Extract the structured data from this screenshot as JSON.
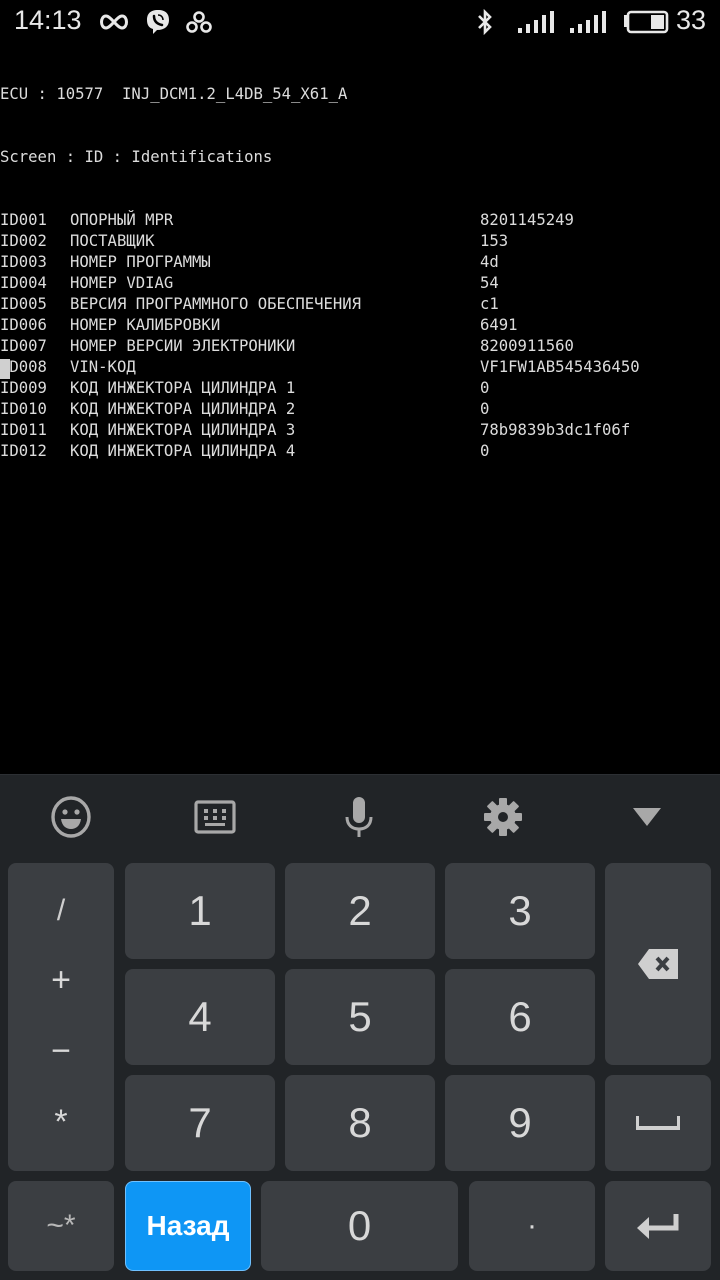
{
  "status_bar": {
    "time": "14:13",
    "left_icons": [
      "infinity-icon",
      "viber-icon",
      "cloverleaf-icon"
    ],
    "right_icons": [
      "bluetooth-icon",
      "signal-sim1-icon",
      "signal-sim2-icon",
      "battery-icon"
    ],
    "battery_level": "33"
  },
  "terminal": {
    "ecu_line": "ECU : 10577  INJ_DCM1.2_L4DB_54_X61_A",
    "screen_line": "Screen : ID : Identifications",
    "rows": [
      {
        "id": "ID001",
        "name": "ОПОРНЫЙ MPR",
        "value": "8201145249"
      },
      {
        "id": "ID002",
        "name": "ПОСТАВЩИК",
        "value": "153"
      },
      {
        "id": "ID003",
        "name": "НОМЕР ПРОГРАММЫ",
        "value": "4d"
      },
      {
        "id": "ID004",
        "name": "НОМЕР VDIAG",
        "value": "54"
      },
      {
        "id": "ID005",
        "name": "ВЕРСИЯ ПРОГРАММНОГО ОБЕСПЕЧЕНИЯ",
        "value": "c1"
      },
      {
        "id": "ID006",
        "name": "НОМЕР КАЛИБРОВКИ",
        "value": "6491"
      },
      {
        "id": "ID007",
        "name": "НОМЕР ВЕРСИИ ЭЛЕКТРОНИКИ",
        "value": "8200911560"
      },
      {
        "id": "ID008",
        "name": "VIN-КОД",
        "value": "VF1FW1AB545436450"
      },
      {
        "id": "ID009",
        "name": "КОД ИНЖЕКТОРА ЦИЛИНДРА 1",
        "value": "0"
      },
      {
        "id": "ID010",
        "name": "КОД ИНЖЕКТОРА ЦИЛИНДРА 2",
        "value": "0"
      },
      {
        "id": "ID011",
        "name": "КОД ИНЖЕКТОРА ЦИЛИНДРА 3",
        "value": "78b9839b3dc1f06f"
      },
      {
        "id": "ID012",
        "name": "КОД ИНЖЕКТОРА ЦИЛИНДРА 4",
        "value": "0"
      }
    ]
  },
  "keyboard": {
    "toolbar": [
      "emoji-icon",
      "keyboard-icon",
      "microphone-icon",
      "settings-gear-icon",
      "hide-keyboard-icon"
    ],
    "symbols": [
      "/",
      "+",
      "−",
      "*"
    ],
    "digits": [
      "1",
      "2",
      "3",
      "4",
      "5",
      "6",
      "7",
      "8",
      "9",
      "0"
    ],
    "symbols_toggle_label": "~*",
    "back_label": "Назад",
    "dot_label": "·",
    "colors": {
      "background": "#212427",
      "key": "#3b3e42",
      "accent": "#0e96f5"
    }
  }
}
